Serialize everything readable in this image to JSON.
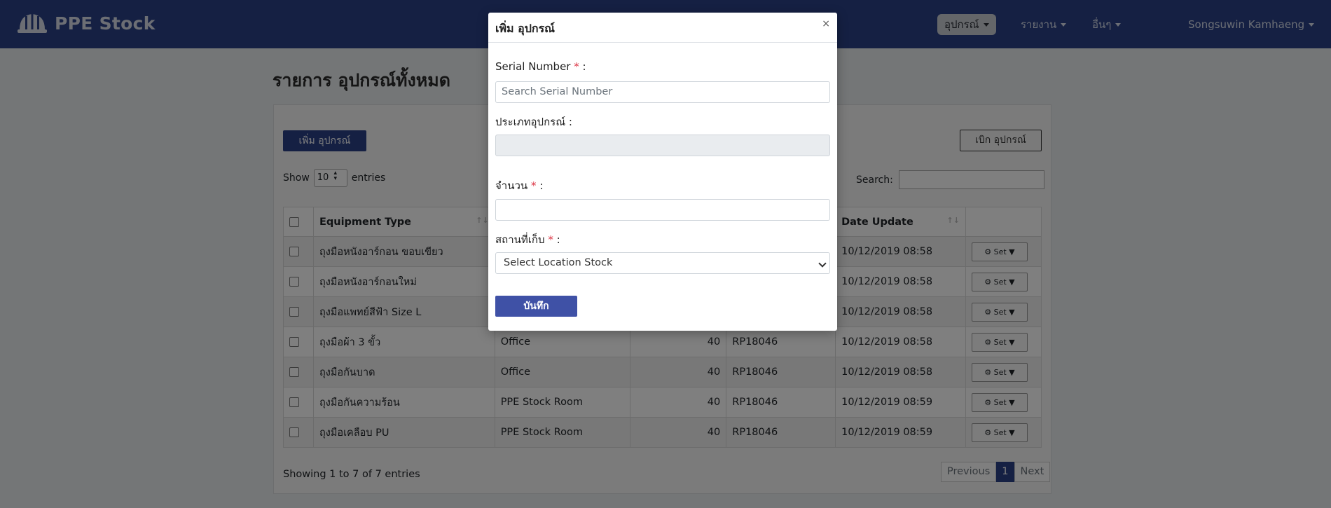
{
  "navbar": {
    "brand": "PPE Stock",
    "menu": [
      {
        "label": "อุปกรณ์",
        "active": true
      },
      {
        "label": "รายงาน",
        "active": false
      },
      {
        "label": "อื่นๆ",
        "active": false
      }
    ],
    "user": "Songsuwin Kamhaeng"
  },
  "page": {
    "title": "รายการ อุปกรณ์ทั้งหมด",
    "add_button": "เพิ่ม อุปกรณ์",
    "withdraw_button": "เบิก อุปกรณ์",
    "show_label": "Show",
    "entries_value": "10",
    "entries_label": "entries",
    "search_label": "Search:",
    "info": "Showing 1 to 7 of 7 entries",
    "pager": {
      "previous": "Previous",
      "current": "1",
      "next": "Next"
    }
  },
  "table": {
    "headers": [
      "Equipment Type",
      "Date Update"
    ],
    "set_label": "Set ▼",
    "rows": [
      {
        "type": "ถุงมือหนังอาร์กอน ขอบเขียว",
        "location": "",
        "qty": "",
        "code": "",
        "date": "10/12/2019 08:58"
      },
      {
        "type": "ถุงมือหนังอาร์กอนใหม่",
        "location": "",
        "qty": "",
        "code": "",
        "date": "10/12/2019 08:58"
      },
      {
        "type": "ถุงมือแพทย์สีฟ้า Size L",
        "location": "",
        "qty": "",
        "code": "",
        "date": "10/12/2019 08:58"
      },
      {
        "type": "ถุงมือผ้า 3 ขั้ว",
        "location": "Office",
        "qty": "40",
        "code": "RP18046",
        "date": "10/12/2019 08:58"
      },
      {
        "type": "ถุงมือกันบาด",
        "location": "Office",
        "qty": "40",
        "code": "RP18046",
        "date": "10/12/2019 08:58"
      },
      {
        "type": "ถุงมือกันความร้อน",
        "location": "PPE Stock Room",
        "qty": "40",
        "code": "RP18046",
        "date": "10/12/2019 08:59"
      },
      {
        "type": "ถุงมือเคลือบ PU",
        "location": "PPE Stock Room",
        "qty": "40",
        "code": "RP18046",
        "date": "10/12/2019 08:59"
      }
    ]
  },
  "modal": {
    "title": "เพิ่ม อุปกรณ์",
    "close": "×",
    "serial_label": "Serial Number",
    "serial_placeholder": "Search Serial Number",
    "type_label": "ประเภทอุปกรณ์ :",
    "qty_label": "จำนวน",
    "location_label": "สถานที่เก็บ",
    "location_select": "Select Location Stock",
    "required_mark": "*",
    "colon": ":",
    "save": "บันทึก"
  },
  "colors": {
    "navbar": "#2a4187",
    "primary": "#3f51a6",
    "required": "#dc3545"
  }
}
